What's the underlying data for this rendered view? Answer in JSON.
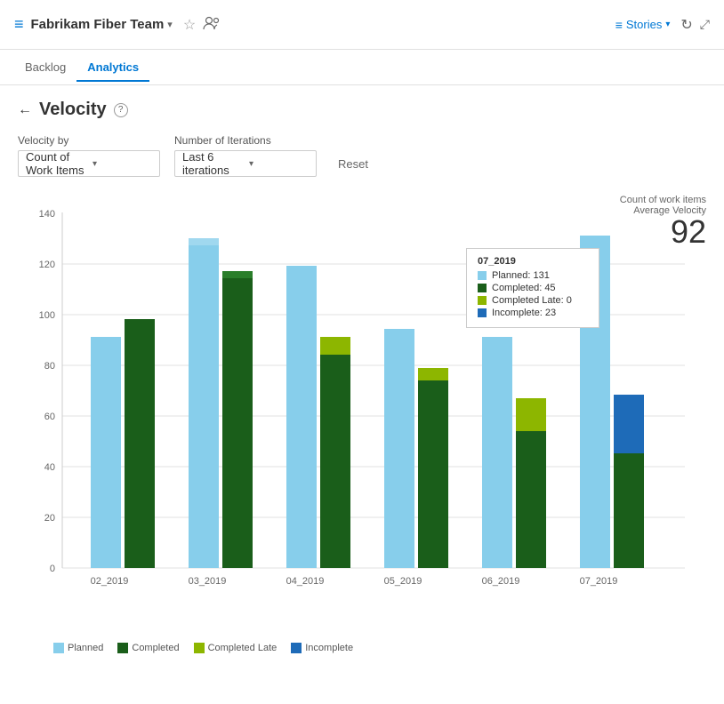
{
  "header": {
    "icon": "≡",
    "title": "Fabrikam Fiber Team",
    "star": "☆",
    "people": "👥",
    "stories_label": "Stories",
    "refresh_icon": "↻",
    "expand_icon": "⤢"
  },
  "nav": {
    "tabs": [
      {
        "id": "backlog",
        "label": "Backlog",
        "active": false
      },
      {
        "id": "analytics",
        "label": "Analytics",
        "active": true
      }
    ]
  },
  "page": {
    "title": "Velocity",
    "back": "←",
    "help": "?"
  },
  "filters": {
    "velocity_by_label": "Velocity by",
    "velocity_by_value": "Count of Work Items",
    "iterations_label": "Number of Iterations",
    "iterations_value": "Last 6 iterations",
    "reset_label": "Reset"
  },
  "chart": {
    "count_label": "Count of work items",
    "avg_label": "Average Velocity",
    "avg_value": "92",
    "y_max": 140,
    "y_step": 20,
    "bars": [
      {
        "label": "02_2019",
        "planned": 91,
        "completed": 98,
        "completed_late": 0,
        "incomplete": 0
      },
      {
        "label": "03_2019",
        "planned": 130,
        "completed": 117,
        "completed_late": 0,
        "incomplete": 0
      },
      {
        "label": "04_2019",
        "planned": 119,
        "completed": 84,
        "completed_late": 7,
        "incomplete": 0
      },
      {
        "label": "05_2019",
        "planned": 94,
        "completed": 74,
        "completed_late": 5,
        "incomplete": 0
      },
      {
        "label": "06_2019",
        "planned": 91,
        "completed": 54,
        "completed_late": 13,
        "incomplete": 0
      },
      {
        "label": "07_2019",
        "planned": 131,
        "completed": 45,
        "completed_late": 0,
        "incomplete": 23
      }
    ],
    "tooltip": {
      "title": "07_2019",
      "planned": 131,
      "completed": 45,
      "completed_late": 0,
      "incomplete": 23
    }
  },
  "legend": {
    "items": [
      {
        "id": "planned",
        "label": "Planned",
        "color": "#87ceeb"
      },
      {
        "id": "completed",
        "label": "Completed",
        "color": "#1a5e1a"
      },
      {
        "id": "completed_late",
        "label": "Completed Late",
        "color": "#8db600"
      },
      {
        "id": "incomplete",
        "label": "Incomplete",
        "color": "#0078d4"
      }
    ]
  },
  "colors": {
    "planned": "#87CEEB",
    "completed": "#1a5e1a",
    "completed_late": "#8db600",
    "incomplete": "#1e6bb8",
    "grid": "#e0e0e0",
    "axis": "#999",
    "accent": "#0078d4"
  }
}
